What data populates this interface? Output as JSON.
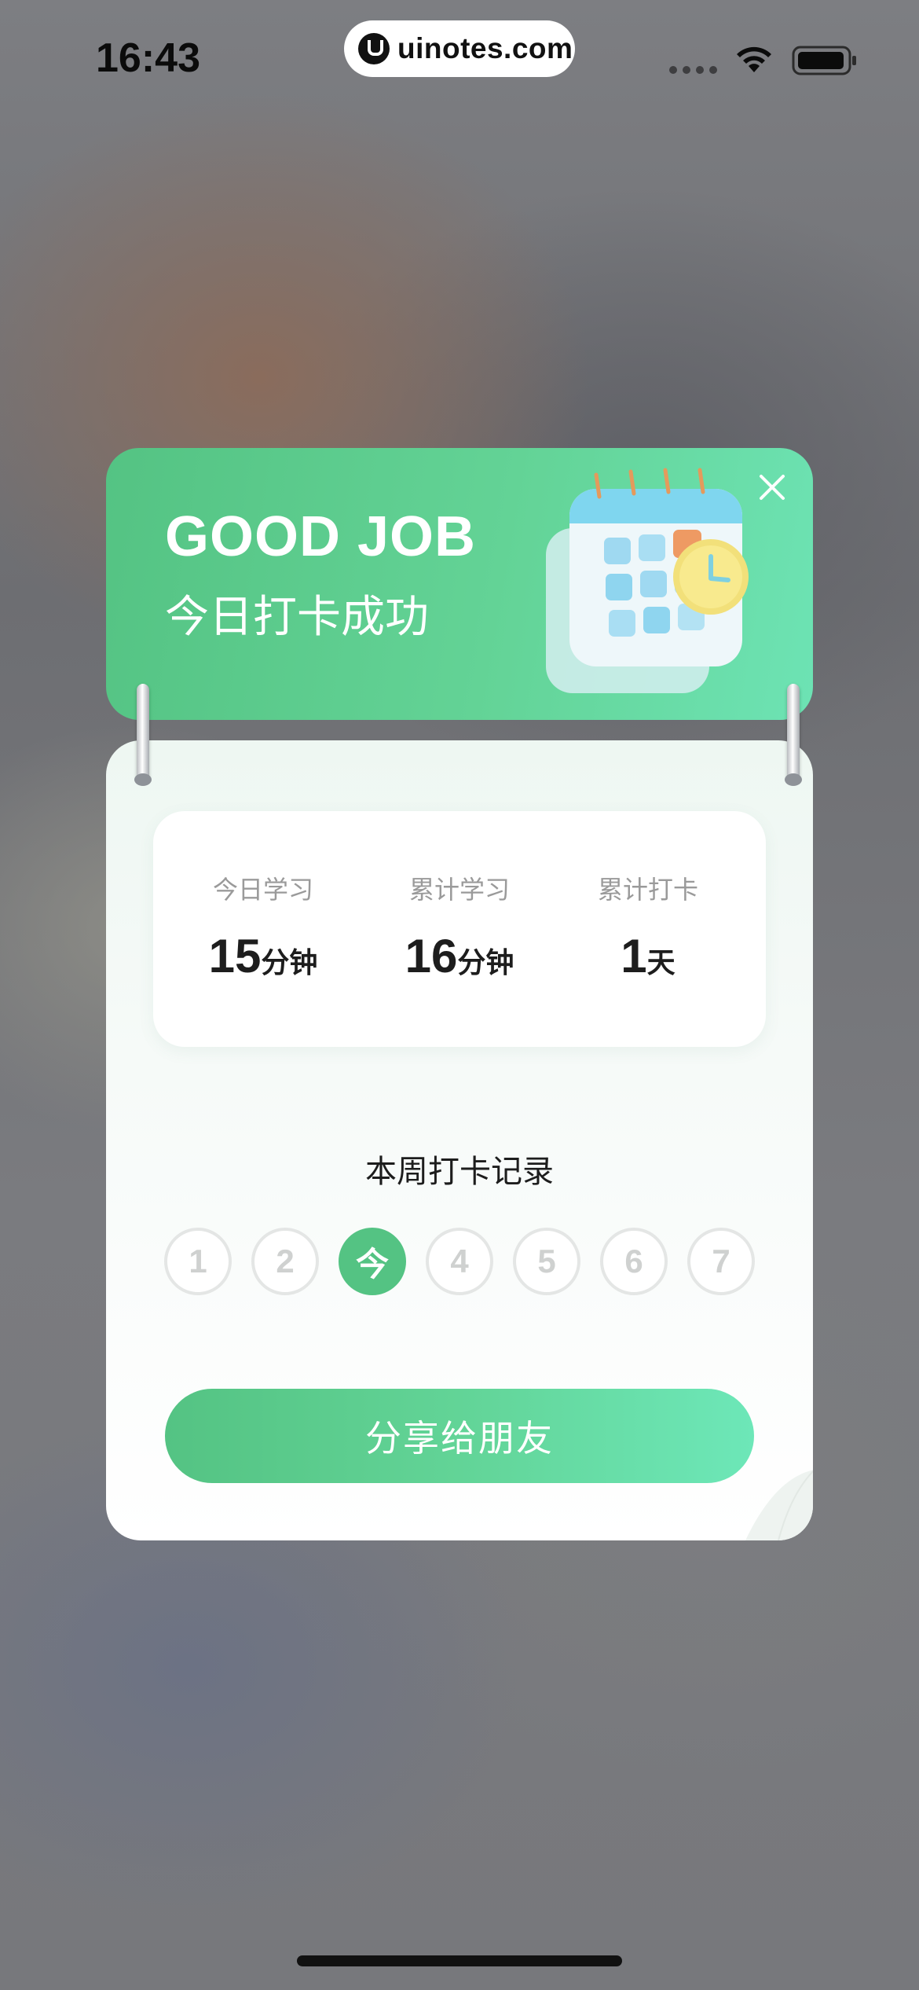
{
  "status_bar": {
    "time": "16:43",
    "url": "uinotes.com"
  },
  "header": {
    "title": "GOOD JOB",
    "subtitle": "今日打卡成功"
  },
  "stats": [
    {
      "label": "今日学习",
      "value": "15",
      "unit": "分钟"
    },
    {
      "label": "累计学习",
      "value": "16",
      "unit": "分钟"
    },
    {
      "label": "累计打卡",
      "value": "1",
      "unit": "天"
    }
  ],
  "week_record": {
    "title": "本周打卡记录",
    "days": [
      "1",
      "2",
      "今",
      "4",
      "5",
      "6",
      "7"
    ],
    "today_index": 2
  },
  "share_button": {
    "label": "分享给朋友"
  },
  "colors": {
    "accent_green": "#54c383",
    "accent_mint": "#6de3b4",
    "day_inactive": "#cfd1d0"
  },
  "icons": [
    "close-icon",
    "calendar-clock-illustration",
    "wifi-icon",
    "battery-icon"
  ]
}
